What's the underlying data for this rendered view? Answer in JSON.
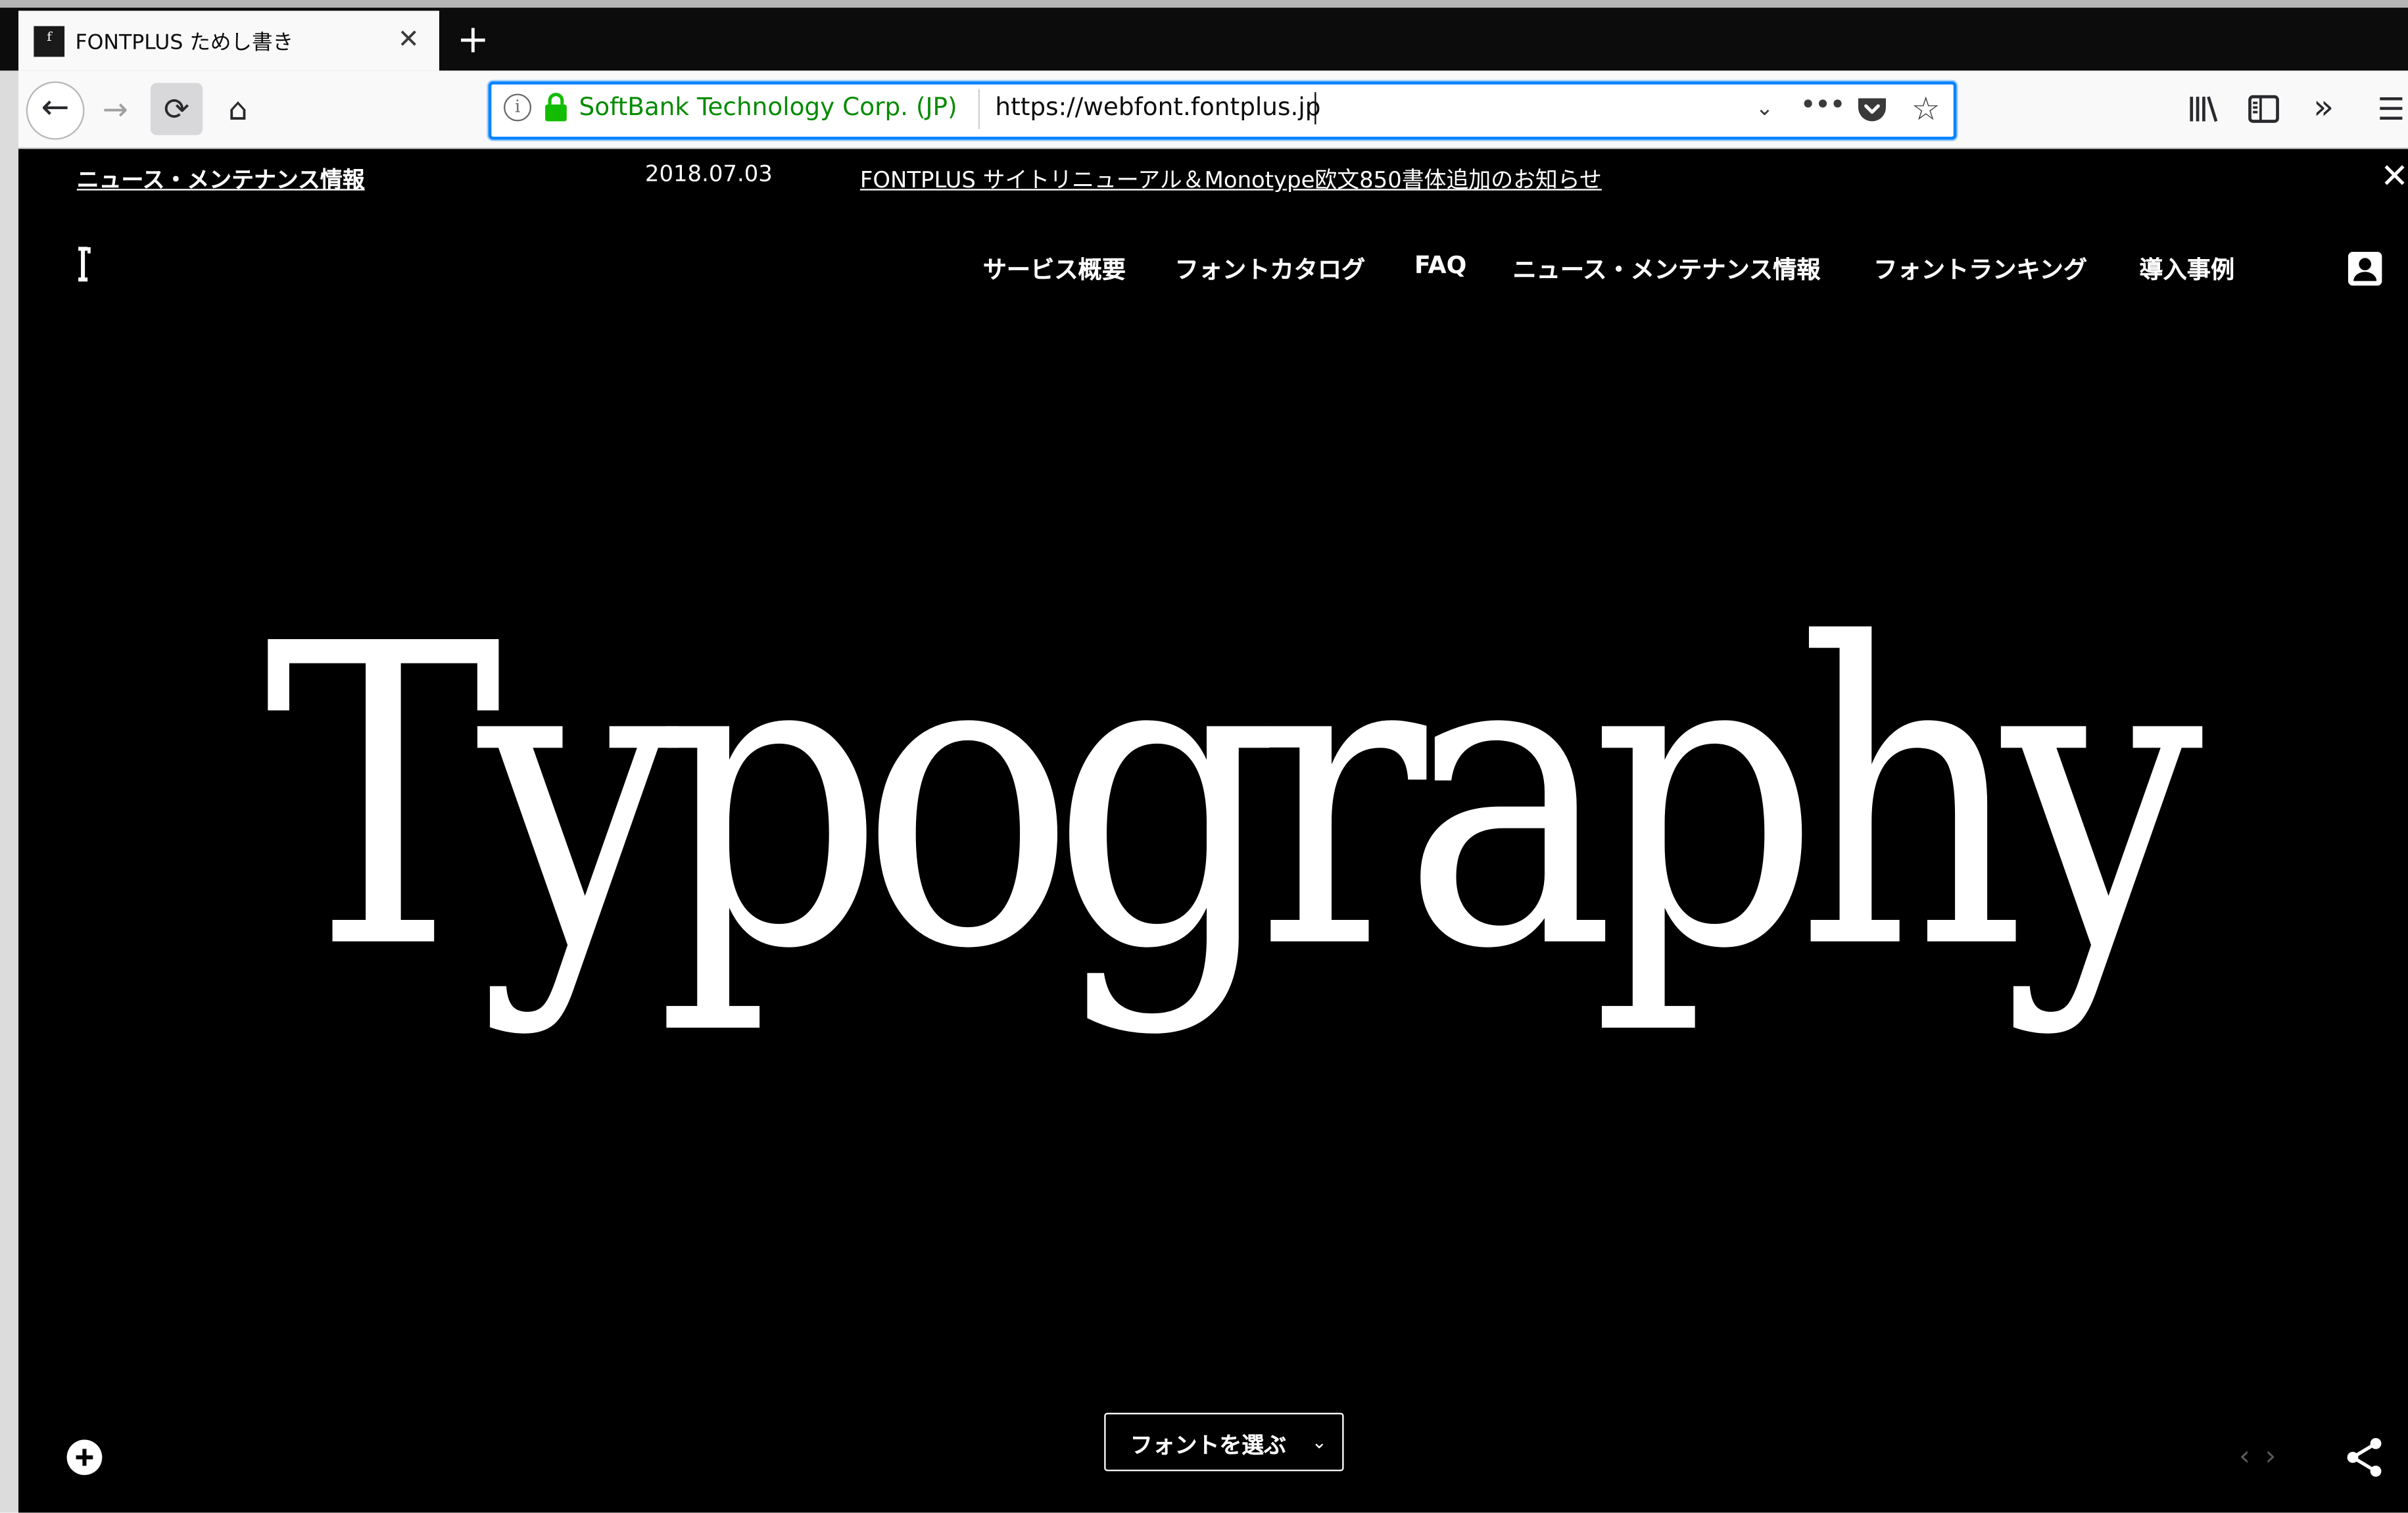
{
  "browser": {
    "tab": {
      "title": "FONTPLUS ためし書き",
      "favicon_icon": "fontplus-favicon-icon",
      "close_glyph": "✕"
    },
    "new_tab_glyph": "+",
    "nav": {
      "back_glyph": "←",
      "forward_glyph": "→",
      "reload_glyph": "⟳",
      "home_glyph": "⌂"
    },
    "urlbar": {
      "info_glyph": "i",
      "identity": "SoftBank Technology Corp. (JP)",
      "url": "https://webfont.fontplus.jp",
      "dropdown_glyph": "⌄",
      "page_actions_glyph": "•••",
      "star_glyph": "☆"
    },
    "toolbar": {
      "overflow_glyph": "»",
      "menu_glyph": "☰"
    },
    "colors": {
      "identity_green": "#058b00",
      "focus_ring": "#0a84ff",
      "tabstrip": "#0c0c0d"
    }
  },
  "site": {
    "news_bar": {
      "label": "ニュース・メンテナンス情報",
      "date": "2018.07.03",
      "headline": "FONTPLUS サイトリニューアル＆Monotype欧文850書体追加のお知らせ",
      "close_glyph": "✕"
    },
    "nav": {
      "items": [
        {
          "label": "サービス概要"
        },
        {
          "label": "フォントカタログ"
        },
        {
          "label": "FAQ"
        },
        {
          "label": "ニュース・メンテナンス情報"
        },
        {
          "label": "フォントランキング"
        },
        {
          "label": "導入事例"
        }
      ]
    },
    "hero": {
      "sample_text": "Typography"
    },
    "footer_controls": {
      "font_select_label": "フォントを選ぶ",
      "font_select_chevron": "⌄",
      "code_glyph": "‹ ›"
    },
    "colors": {
      "background": "#000000",
      "text": "#ffffff"
    }
  }
}
